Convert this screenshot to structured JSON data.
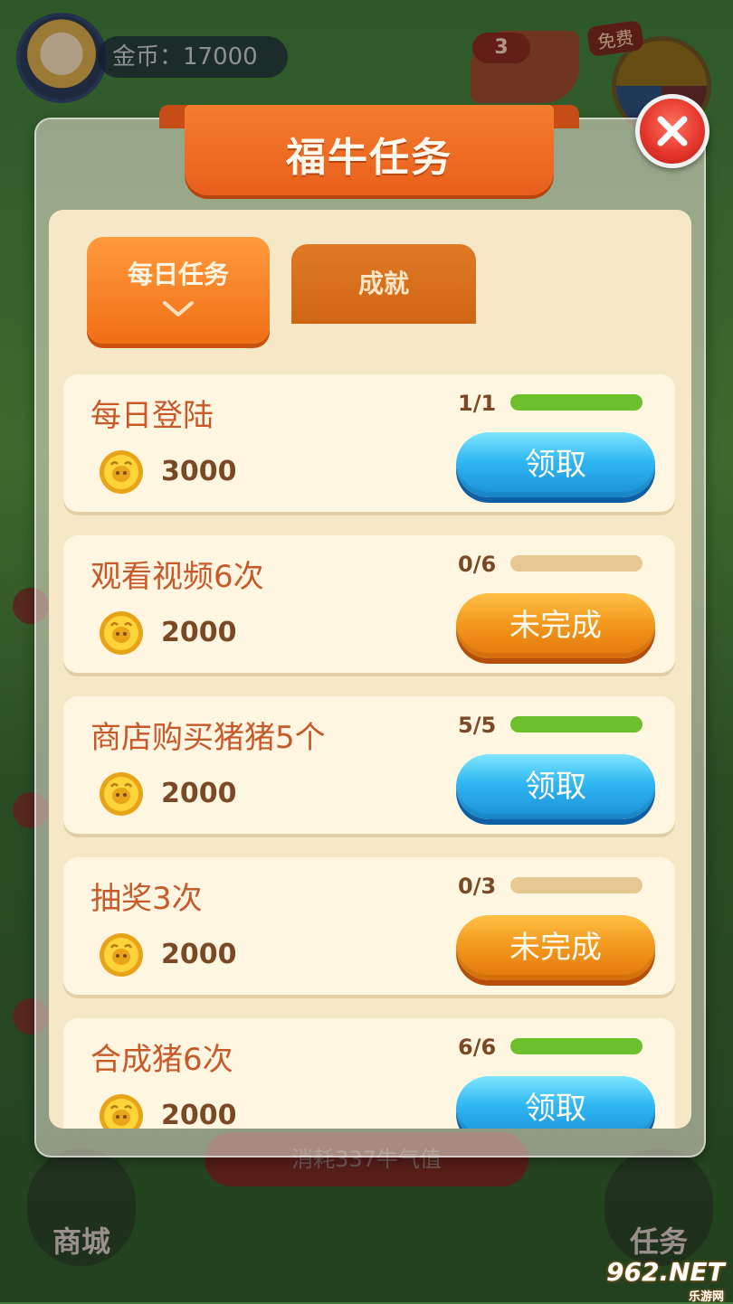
{
  "background": {
    "coin_label": "金币：17000",
    "free_badge": "免费",
    "plane_count": "3",
    "bottom_button": "消耗337牛气值",
    "shop_label": "商城",
    "task_label": "任务"
  },
  "modal": {
    "title": "福牛任务",
    "close_icon": "close-icon",
    "tabs": [
      {
        "label": "每日任务",
        "active": true
      },
      {
        "label": "成就",
        "active": false
      }
    ],
    "tasks": [
      {
        "title": "每日登陆",
        "reward": "3000",
        "progress": "1/1",
        "progress_fraction": 1.0,
        "button": "领取",
        "state": "claim"
      },
      {
        "title": "观看视频6次",
        "reward": "2000",
        "progress": "0/6",
        "progress_fraction": 0.0,
        "button": "未完成",
        "state": "incomplete"
      },
      {
        "title": "商店购买猪猪5个",
        "reward": "2000",
        "progress": "5/5",
        "progress_fraction": 1.0,
        "button": "领取",
        "state": "claim"
      },
      {
        "title": "抽奖3次",
        "reward": "2000",
        "progress": "0/3",
        "progress_fraction": 0.0,
        "button": "未完成",
        "state": "incomplete"
      },
      {
        "title": "合成猪6次",
        "reward": "2000",
        "progress": "6/6",
        "progress_fraction": 1.0,
        "button": "领取",
        "state": "claim"
      }
    ]
  },
  "watermark": {
    "main": "962.NET",
    "sub": "乐游网"
  },
  "colors": {
    "accent_orange": "#f06f16",
    "claim_blue": "#2fb7f2",
    "progress_green": "#6cc02b",
    "title_text": "#c65a2b"
  }
}
